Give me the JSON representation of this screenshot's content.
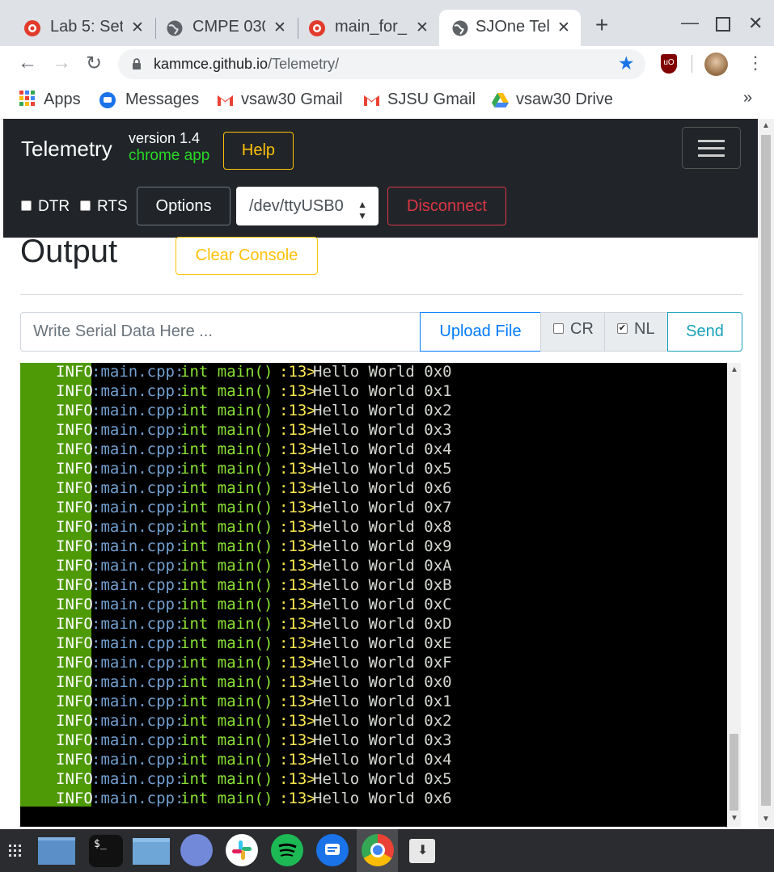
{
  "browser": {
    "tabs": [
      {
        "title": "Lab 5: Set",
        "active": false
      },
      {
        "title": "CMPE 030",
        "active": false
      },
      {
        "title": "main_for_",
        "active": false
      },
      {
        "title": "SJOne Tel",
        "active": true
      }
    ],
    "url_host": "kammce.github.io",
    "url_path": "/Telemetry/",
    "bookmarks": [
      {
        "label": "Apps"
      },
      {
        "label": "Messages"
      },
      {
        "label": "vsaw30 Gmail"
      },
      {
        "label": "SJSU Gmail"
      },
      {
        "label": "vsaw30 Drive"
      }
    ],
    "overflow": "»"
  },
  "navbar": {
    "brand": "Telemetry",
    "version": "version 1.4",
    "chrome_app": "chrome app",
    "help_label": "Help",
    "dtr_label": "DTR",
    "rts_label": "RTS",
    "options_label": "Options",
    "port": "/dev/ttyUSB0",
    "disconnect_label": "Disconnect"
  },
  "output": {
    "title": "Output",
    "clear_label": "Clear Console",
    "input_placeholder": "Write Serial Data Here ...",
    "upload_label": "Upload File",
    "cr_label": "CR",
    "cr_checked": false,
    "nl_label": "NL",
    "nl_checked": true,
    "send_label": "Send"
  },
  "console": {
    "level": "INFO",
    "file": ":main.cpp:",
    "func": "int main()",
    "line": ":13>",
    "lines": [
      "Hello World 0x0",
      "Hello World 0x1",
      "Hello World 0x2",
      "Hello World 0x3",
      "Hello World 0x4",
      "Hello World 0x5",
      "Hello World 0x6",
      "Hello World 0x7",
      "Hello World 0x8",
      "Hello World 0x9",
      "Hello World 0xA",
      "Hello World 0xB",
      "Hello World 0xC",
      "Hello World 0xD",
      "Hello World 0xE",
      "Hello World 0xF",
      "Hello World 0x0",
      "Hello World 0x1",
      "Hello World 0x2",
      "Hello World 0x3",
      "Hello World 0x4",
      "Hello World 0x5",
      "Hello World 0x6"
    ]
  },
  "colors": {
    "navbar_bg": "#212529",
    "help_warning": "#ffc107",
    "disconnect_danger": "#dc3545",
    "upload_primary": "#007bff",
    "send_info": "#17a2b8",
    "console_gutter": "#4e9a06",
    "chrome_app_green": "#28d728"
  },
  "shelf": {
    "apps": [
      "files-app-icon",
      "terminal-icon",
      "folder-icon",
      "discord-icon",
      "slack-icon",
      "spotify-icon",
      "messages-app-icon",
      "chrome-icon",
      "downloads-icon"
    ]
  }
}
